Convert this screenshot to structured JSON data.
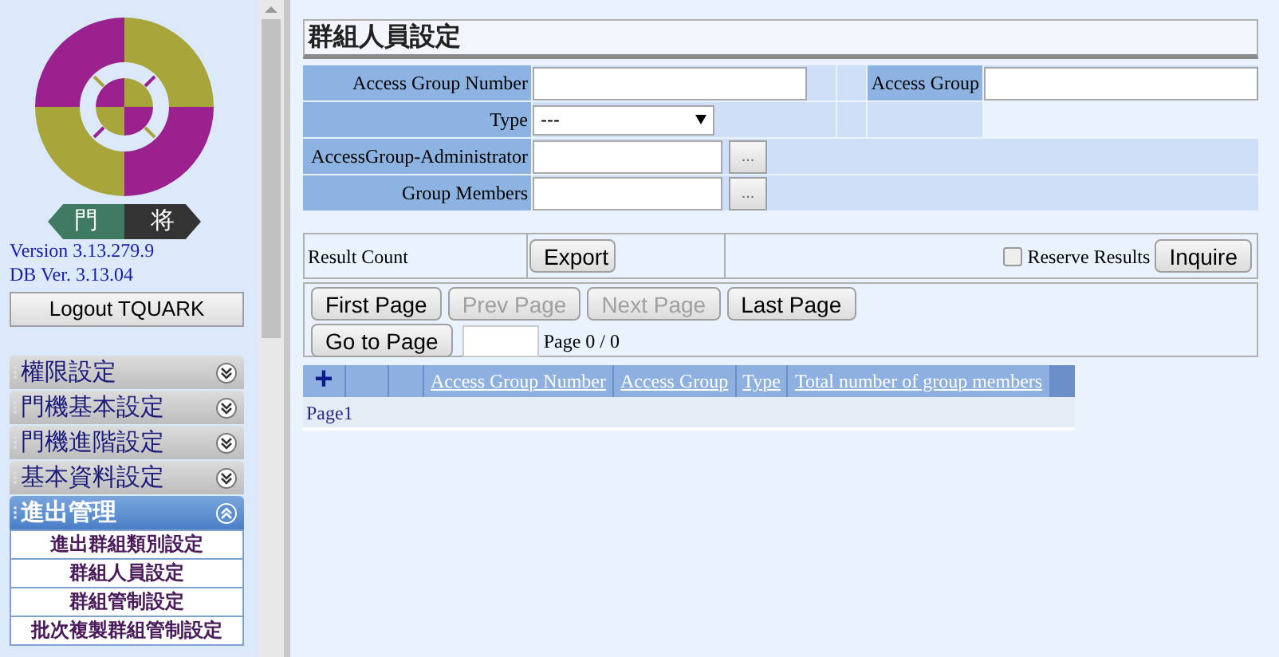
{
  "sidebar": {
    "logo": {
      "left": "門",
      "right": "将"
    },
    "version": "Version 3.13.279.9",
    "db_version": "DB Ver. 3.13.04",
    "logout_button": "Logout TQUARK",
    "menu": [
      {
        "label": "權限設定",
        "expanded": false
      },
      {
        "label": "門機基本設定",
        "expanded": false
      },
      {
        "label": "門機進階設定",
        "expanded": false
      },
      {
        "label": "基本資料設定",
        "expanded": false
      },
      {
        "label": "進出管理",
        "expanded": true,
        "children": [
          {
            "label": "進出群組類別設定"
          },
          {
            "label": "群組人員設定"
          },
          {
            "label": "群組管制設定"
          },
          {
            "label": "批次複製群組管制設定"
          }
        ]
      }
    ]
  },
  "page_title": "群組人員設定",
  "form": {
    "access_group_number": {
      "label": "Access Group Number"
    },
    "access_group": {
      "label": "Access Group"
    },
    "type": {
      "label": "Type",
      "value": "---"
    },
    "administrator": {
      "label": "AccessGroup-Administrator",
      "browse": "..."
    },
    "group_members": {
      "label": "Group Members",
      "browse": "..."
    }
  },
  "results": {
    "result_count": "Result Count",
    "export_button": "Export",
    "reserve_results": {
      "label": "Reserve Results",
      "checked": false
    },
    "inquire_button": "Inquire"
  },
  "pager": {
    "buttons": [
      {
        "label": "First Page",
        "disabled": false
      },
      {
        "label": "Prev Page",
        "disabled": true
      },
      {
        "label": "Next Page",
        "disabled": true
      },
      {
        "label": "Last Page",
        "disabled": false
      }
    ],
    "goto_button": "Go to Page",
    "page_info": "Page 0 / 0"
  },
  "table": {
    "add": "+",
    "columns": [
      "Access Group Number",
      "Access Group",
      "Type",
      "Total number of group members"
    ],
    "footer": "Page1"
  }
}
